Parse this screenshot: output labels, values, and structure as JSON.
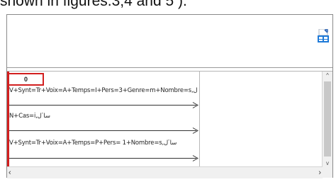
{
  "caption": "shown in figures.3;4 and 5 ).",
  "toolbar": {
    "export_icon": "export-excel-icon"
  },
  "list": {
    "counter": "0",
    "rows": [
      "V+Synt=Tr+Voix=A+Temps=I+Pers=3+Genre=m+Nombre=s,ساٴل",
      "N+Cas=i,ساٴل",
      "V+Synt=Tr+Voix=A+Temps=P+Pers= 1+Nombre=s,ساٴل"
    ]
  },
  "scrollbar": {
    "left_arrow": "‹",
    "right_arrow": "›",
    "up_arrow": "^",
    "down_arrow": "v"
  },
  "colors": {
    "highlight": "#d21f1f",
    "frame": "#8a8a8a"
  }
}
